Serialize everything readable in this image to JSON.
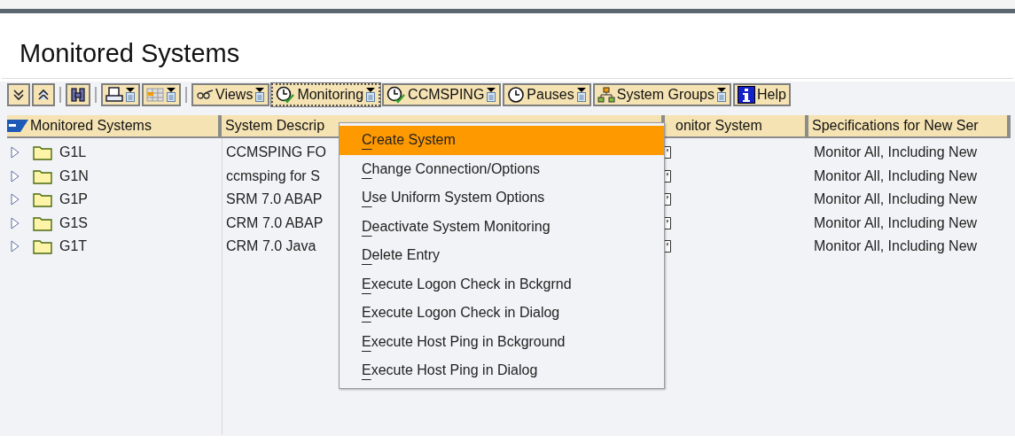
{
  "title": "Monitored Systems",
  "toolbar": [
    {
      "buttons": [
        {
          "kind": "expand",
          "dropdown": false,
          "active": false
        },
        {
          "kind": "collapse",
          "dropdown": false,
          "active": false
        }
      ]
    },
    {
      "buttons": [
        {
          "kind": "find",
          "dropdown": false,
          "active": false
        }
      ]
    },
    {
      "buttons": [
        {
          "kind": "print",
          "dropdown": true,
          "active": false
        },
        {
          "kind": "layout",
          "dropdown": true,
          "active": false
        }
      ]
    },
    {
      "buttons": [
        {
          "kind": "views",
          "label": "Views",
          "dropdown": true,
          "active": false
        },
        {
          "kind": "monitor",
          "label": "Monitoring",
          "dropdown": true,
          "active": true
        },
        {
          "kind": "monitor",
          "label": "CCMSPING",
          "dropdown": true,
          "active": false
        },
        {
          "kind": "clock",
          "label": "Pauses",
          "dropdown": true,
          "active": false
        },
        {
          "kind": "groups",
          "label": "System Groups",
          "dropdown": true,
          "active": false
        },
        {
          "kind": "help",
          "label": "Help",
          "dropdown": false,
          "active": false
        }
      ]
    }
  ],
  "table": {
    "columns": [
      "Monitored Systems",
      "System Descrip",
      "onitor System",
      "Specifications for New Ser"
    ],
    "rows": [
      {
        "name": "G1L",
        "expanded": false,
        "description": "CCMSPING FO",
        "monitor": true,
        "specification": "Monitor All, Including New"
      },
      {
        "name": "G1N",
        "expanded": false,
        "description": "ccmsping for S",
        "monitor": true,
        "specification": "Monitor All, Including New"
      },
      {
        "name": "G1P",
        "expanded": false,
        "description": "SRM 7.0 ABAP",
        "monitor": true,
        "specification": "Monitor All, Including New"
      },
      {
        "name": "G1S",
        "expanded": false,
        "description": "CRM 7.0 ABAP",
        "monitor": true,
        "specification": "Monitor All, Including New"
      },
      {
        "name": "G1T",
        "expanded": false,
        "description": "CRM 7.0 Java",
        "monitor": true,
        "specification": "Monitor All, Including New"
      }
    ]
  },
  "menu": {
    "items": [
      {
        "label": "Create System",
        "selected": true
      },
      {
        "label": "Change Connection/Options",
        "selected": false
      },
      {
        "label": "Use Uniform System Options",
        "selected": false
      },
      {
        "label": "Deactivate System Monitoring",
        "selected": false
      },
      {
        "label": "Delete Entry",
        "selected": false
      },
      {
        "label": "Execute Logon Check in Bckgrnd",
        "selected": false
      },
      {
        "label": "Execute Logon Check in Dialog",
        "selected": false
      },
      {
        "label": "Execute Host Ping in Bckground",
        "selected": false
      },
      {
        "label": "Execute Host Ping in Dialog",
        "selected": false
      }
    ]
  }
}
